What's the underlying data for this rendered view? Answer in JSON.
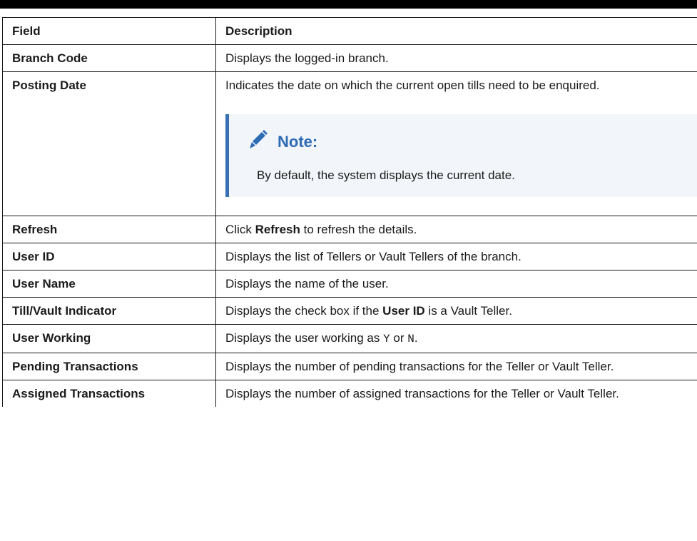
{
  "table": {
    "headers": {
      "field": "Field",
      "description": "Description"
    },
    "rows": [
      {
        "field": "Branch Code",
        "description": "Displays the logged-in branch."
      },
      {
        "field": "Posting Date",
        "description": "Indicates the date on which the current open tills need to be enquired."
      },
      {
        "field": "Refresh",
        "description_pre": "Click ",
        "description_bold": "Refresh",
        "description_post": " to refresh the details."
      },
      {
        "field": "User ID",
        "description": "Displays the list of Tellers or Vault Tellers of the branch."
      },
      {
        "field": "User Name",
        "description": "Displays the name of the user."
      },
      {
        "field": "Till/Vault Indicator",
        "description_pre": "Displays the check box if the ",
        "description_bold": "User ID",
        "description_post": " is a Vault Teller."
      },
      {
        "field": "User Working",
        "description_pre": "Displays the user working as ",
        "code_1": "Y",
        "description_mid": " or ",
        "code_2": "N",
        "description_post": "."
      },
      {
        "field": "Pending Transactions",
        "description": "Displays the number of pending transactions for the Teller or Vault Teller."
      },
      {
        "field": "Assigned Transactions",
        "description": "Displays the number of assigned transactions for the Teller or Vault Teller."
      }
    ]
  },
  "note": {
    "title": "Note:",
    "body": "By default, the system displays the current date.",
    "icon": "pencil-icon",
    "accent_color": "#3a71b5",
    "background_color": "#f2f6fa"
  }
}
